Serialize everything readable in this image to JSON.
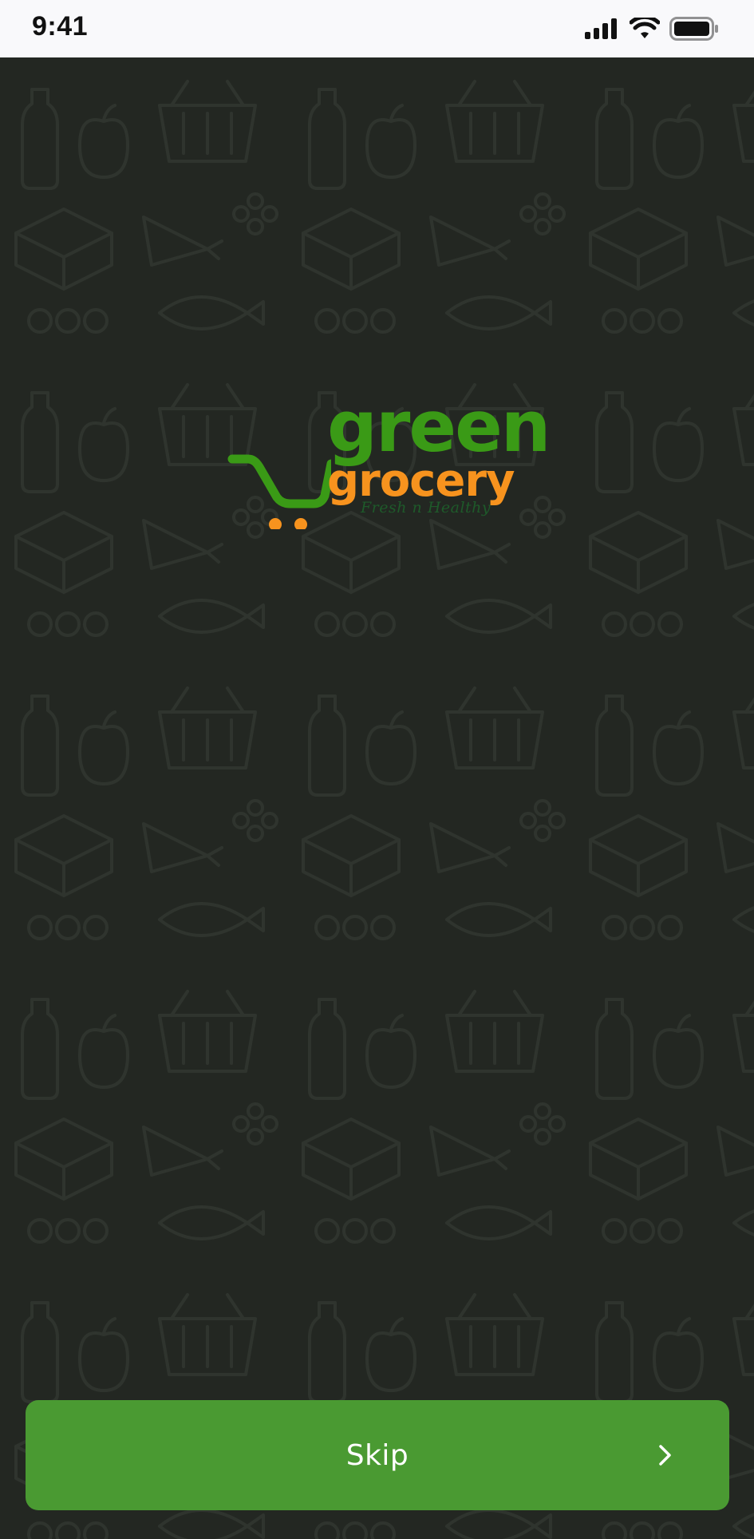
{
  "status_bar": {
    "time": "9:41",
    "icons": [
      "cellular-signal-icon",
      "wifi-icon",
      "battery-icon"
    ]
  },
  "background": {
    "color": "#232722",
    "pattern": "grocery-doodle-pattern"
  },
  "logo": {
    "word1": "green",
    "word2": "grocery",
    "tagline": "Fresh n Healthy",
    "colors": {
      "green": "#3a9a16",
      "orange": "#f7931e",
      "tagline": "#1e5a2a"
    }
  },
  "skip_button": {
    "label": "Skip",
    "icon": "chevron-right-icon",
    "color": "#4a9a32"
  }
}
